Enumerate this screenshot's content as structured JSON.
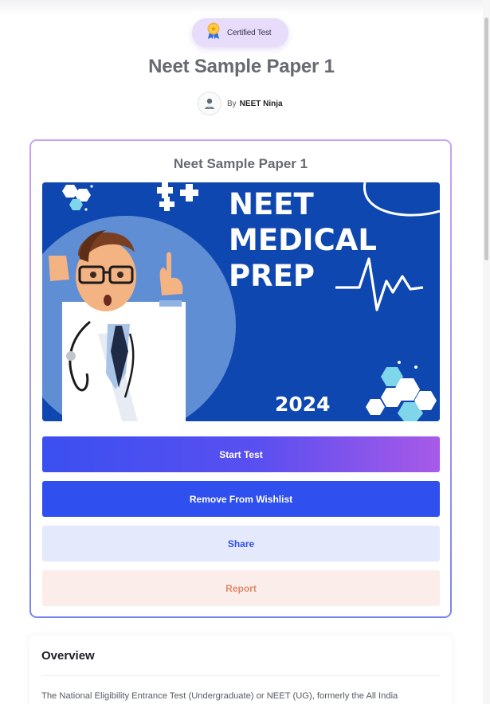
{
  "badge": {
    "label": "Certified Test",
    "icon": "award-medal-icon"
  },
  "page_title": "Neet Sample Paper 1",
  "author": {
    "prefix": "By",
    "name": "NEET Ninja",
    "avatar_icon": "user-avatar-icon"
  },
  "card": {
    "title": "Neet Sample Paper 1",
    "banner": {
      "line1": "NEET",
      "line2": "MEDICAL",
      "line3": "PREP",
      "year": "2024"
    }
  },
  "buttons": {
    "start": "Start Test",
    "remove": "Remove From Wishlist",
    "share": "Share",
    "report": "Report"
  },
  "overview": {
    "title": "Overview",
    "text": "The National Eligibility Entrance Test (Undergraduate) or NEET (UG), formerly the All India"
  },
  "colors": {
    "accent_blue": "#2f4fee",
    "banner_blue": "#0f47b0",
    "report_text": "#e08a6c",
    "share_bg": "#e4e9fc"
  }
}
